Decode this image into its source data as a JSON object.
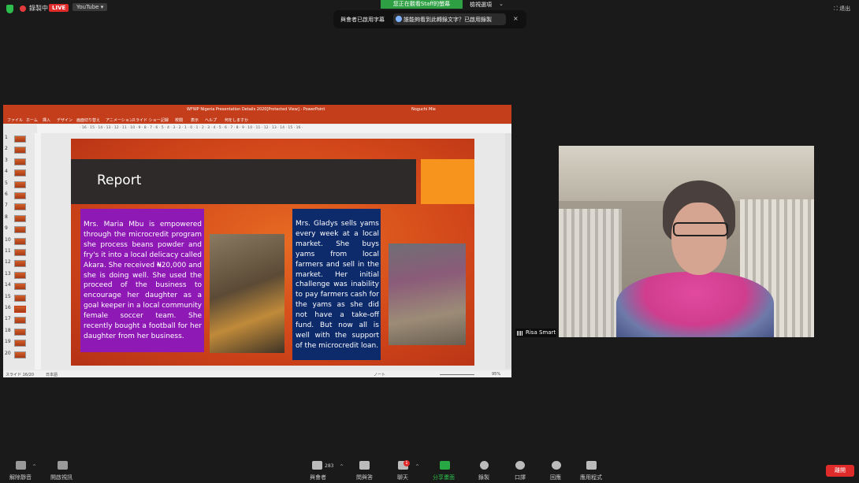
{
  "topbar": {
    "recording_label": "錄製中",
    "live_badge": "LIVE",
    "youtube_dropdown": "YouTube ▾",
    "watching_banner": "您正在觀看Staff的螢幕",
    "view_options": "檢視選項",
    "view_chevron": "⌄",
    "fullscreen_label": "⛶ 退出"
  },
  "caption_banner": {
    "enabled_text": "與會者已啟用字幕",
    "request_text": "誰能夠看到此轉錄文字？已啟用錄製",
    "close": "×"
  },
  "ppt": {
    "window_title": "WFWP Nigeria Presentation Details 2020[Protected View]  -  PowerPoint",
    "user_label": "Noguchi Mie",
    "ribbon_tabs": [
      "ファイル",
      "ホーム",
      "挿入",
      "デザイン",
      "画面切り替え",
      "アニメーション",
      "スライド ショー",
      "記録",
      "校閲",
      "表示",
      "ヘルプ",
      "何をしますか"
    ],
    "ruler_text": "· 16 · 15 · 14 · 13 · 12 · 11 · 10 · 9 · 8 · 7 · 6 · 5 · 4 · 3 · 2 · 1 · 0 · 1 · 2 · 3 · 4 · 5 · 6 · 7 · 8 · 9 · 10 · 11 · 12 · 13 · 14 · 15 · 16 ·",
    "thumb_numbers": [
      "1",
      "2",
      "3",
      "4",
      "5",
      "6",
      "7",
      "8",
      "9",
      "10",
      "11",
      "12",
      "13",
      "14",
      "15",
      "16",
      "17",
      "18",
      "19",
      "20"
    ],
    "status_slide": "スライド 16/20",
    "status_lang": "日本語",
    "status_notes": "ノート",
    "status_zoom": "95%",
    "slide": {
      "title": "Report",
      "purple_text": "Mrs. Maria Mbu is empowered through the microcredit program she process beans powder and fry's it into a local delicacy called Akara. She received ₦20,000 and she is doing well. She used the proceed of the business to encourage her daughter as a goal keeper in a local community female soccer team. She recently bought a football for her daughter from her business.",
      "blue_text": "Mrs. Gladys sells yams every week at a local market. She buys yams from local farmers and sell in the market. Her initial challenge was inability to pay farmers cash for the yams as she did not have a take-off fund. But now all is well with the support of the microcredit loan."
    }
  },
  "camera": {
    "participant_name": "Risa Smart"
  },
  "toolbar": {
    "unmute": "解除靜音",
    "start_video": "開啟視訊",
    "participants": "與會者",
    "participant_count": "283",
    "qa": "問與答",
    "chat": "聊天",
    "chat_badge": "1",
    "share_screen": "分享畫面",
    "record": "錄製",
    "interpretation": "口譯",
    "reactions": "回應",
    "apps": "應用程式",
    "end": "離開"
  },
  "colors": {
    "ppt_accent": "#c43e1c",
    "slide_purple": "#8e19b5",
    "slide_blue": "#0d2a6b",
    "slide_orange": "#f7941d",
    "live_red": "#e02b2b",
    "share_green": "#27a844"
  }
}
